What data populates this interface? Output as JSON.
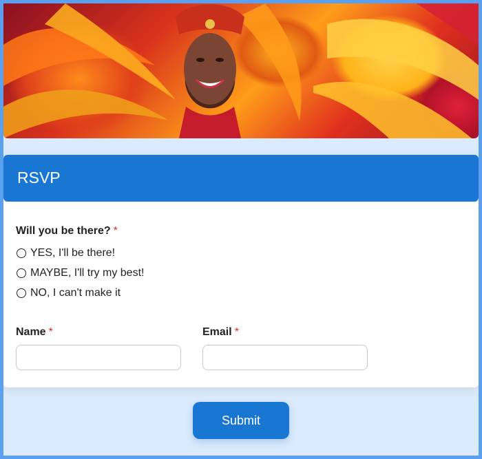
{
  "banner": {
    "image_description_icon": "carnival-dancer-photo"
  },
  "form": {
    "title": "RSVP",
    "attendance": {
      "label": "Will you be there?",
      "required_mark": "*",
      "options": [
        {
          "label": "YES, I'll be there!"
        },
        {
          "label": "MAYBE, I'll try my best!"
        },
        {
          "label": "NO, I can't make it"
        }
      ]
    },
    "name": {
      "label": "Name",
      "required_mark": "*",
      "value": ""
    },
    "email": {
      "label": "Email",
      "required_mark": "*",
      "value": ""
    },
    "submit_label": "Submit"
  },
  "colors": {
    "accent": "#1976d2",
    "required": "#d32f2f",
    "frame": "#5aa0ee",
    "page_background": "#dbeafc"
  }
}
